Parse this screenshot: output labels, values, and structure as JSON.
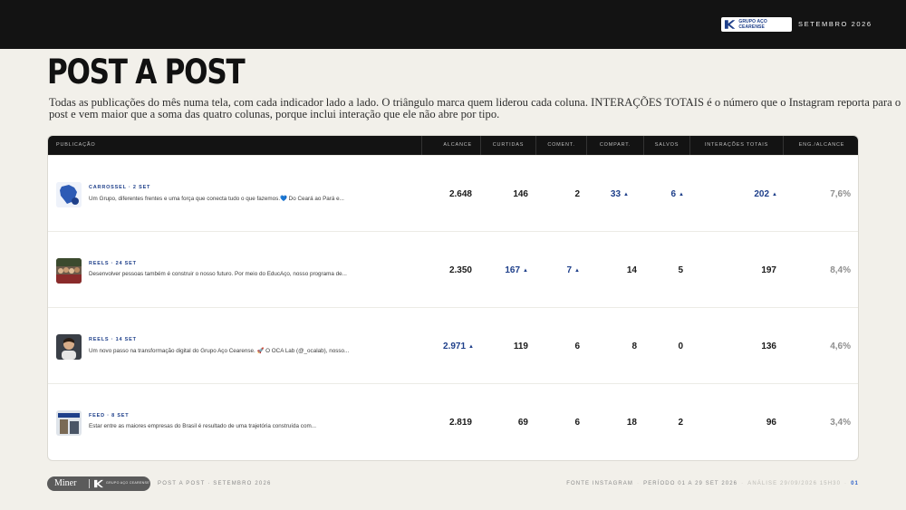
{
  "header": {
    "brand_text": "GRUPO AÇO CEARENSE",
    "period": "SETEMBRO 2026",
    "accent": "#1e3f8a"
  },
  "page": {
    "title": "POST A POST",
    "subtitle": "Todas as publicações do mês numa tela, com cada indicador lado a lado. O triângulo marca quem liderou cada coluna. INTERAÇÕES TOTAIS é o número que o Instagram reporta para o post e vem maior que a soma das quatro colunas, porque inclui interação que ele não abre por tipo."
  },
  "table": {
    "columns": [
      "PUBLICAÇÃO",
      "ALCANCE",
      "CURTIDAS",
      "COMENT.",
      "COMPART.",
      "SALVOS",
      "INTERAÇÕES TOTAIS",
      "ENG./ALCANCE"
    ],
    "lead_marker": "▲",
    "rows": [
      {
        "type_date": "CARROSSEL · 2 set",
        "caption": "Um Grupo, diferentes frentes e uma força que conecta tudo o que fazemos.💙 Do Ceará ao Pará e...",
        "thumb": "map-thumb",
        "alcance": "2.648",
        "curtidas": "146",
        "coment": "2",
        "compart": "33",
        "salvos": "6",
        "interacoes": "202",
        "eng": "7,6%",
        "lead": [
          "compart",
          "salvos",
          "interacoes"
        ]
      },
      {
        "type_date": "REELS · 24 set",
        "caption": "Desenvolver pessoas também é construir o nosso futuro. Por meio do EducAço, nosso programa de...",
        "thumb": "group-photo-thumb",
        "alcance": "2.350",
        "curtidas": "167",
        "coment": "7",
        "compart": "14",
        "salvos": "5",
        "interacoes": "197",
        "eng": "8,4%",
        "lead": [
          "curtidas",
          "coment"
        ]
      },
      {
        "type_date": "REELS · 14 set",
        "caption": "Um novo passo na transformação digital do Grupo Aço Cearense. 🚀 O OCA Lab (@_ocalab), nosso...",
        "thumb": "person-photo-thumb",
        "alcance": "2.971",
        "curtidas": "119",
        "coment": "6",
        "compart": "8",
        "salvos": "0",
        "interacoes": "136",
        "eng": "4,6%",
        "lead": [
          "alcance"
        ]
      },
      {
        "type_date": "FEED · 8 set",
        "caption": "Estar entre as maiores empresas do Brasil é resultado de uma trajetória construída com...",
        "thumb": "feed-photo-thumb",
        "alcance": "2.819",
        "curtidas": "69",
        "coment": "6",
        "compart": "18",
        "salvos": "2",
        "interacoes": "96",
        "eng": "3,4%",
        "lead": []
      }
    ]
  },
  "footer": {
    "pill_brand": "Miner",
    "pill_partner": "GRUPO AÇO CEARENSE",
    "left": "POST A POST · SETEMBRO 2026",
    "source": "FONTE INSTAGRAM",
    "period": "PERÍODO 01 A 29 SET 2026",
    "analysis": "ANÁLISE 29/09/2026 15H30",
    "page": "01",
    "separator": "·"
  }
}
